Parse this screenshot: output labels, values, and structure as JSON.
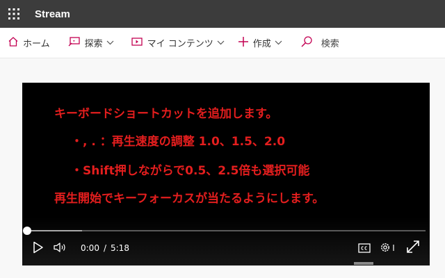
{
  "app": {
    "title": "Stream"
  },
  "nav": {
    "home_label": "ホーム",
    "explore_label": "探索",
    "mycontent_label": "マイ コンテンツ",
    "create_label": "作成",
    "search_placeholder": "検索"
  },
  "video": {
    "overlay_lines": [
      "キーボードショートカットを追加します。",
      "・, . ：再生速度の調整 1.0、1.5、2.0",
      "・Shift押しながらで0.5、2.5倍も選択可能",
      "再生開始でキーフォーカスが当たるようにします。"
    ],
    "current_time": "0:00",
    "time_separator": "/",
    "duration": "5:18",
    "played_fraction": 0.0,
    "buffered_fraction": 0.14
  },
  "colors": {
    "topbar": "#3c3c3c",
    "accent": "#c30052",
    "overlay_text": "#e41e1e"
  },
  "icons": {
    "waffle": "app-launcher-icon",
    "home": "home-icon",
    "explore": "explore-icon",
    "mycontent": "video-icon",
    "create": "plus-icon",
    "search": "search-icon",
    "play": "play-icon",
    "volume": "volume-icon",
    "captions": "closed-captions-icon",
    "settings": "gear-icon",
    "fullscreen": "fullscreen-icon"
  }
}
